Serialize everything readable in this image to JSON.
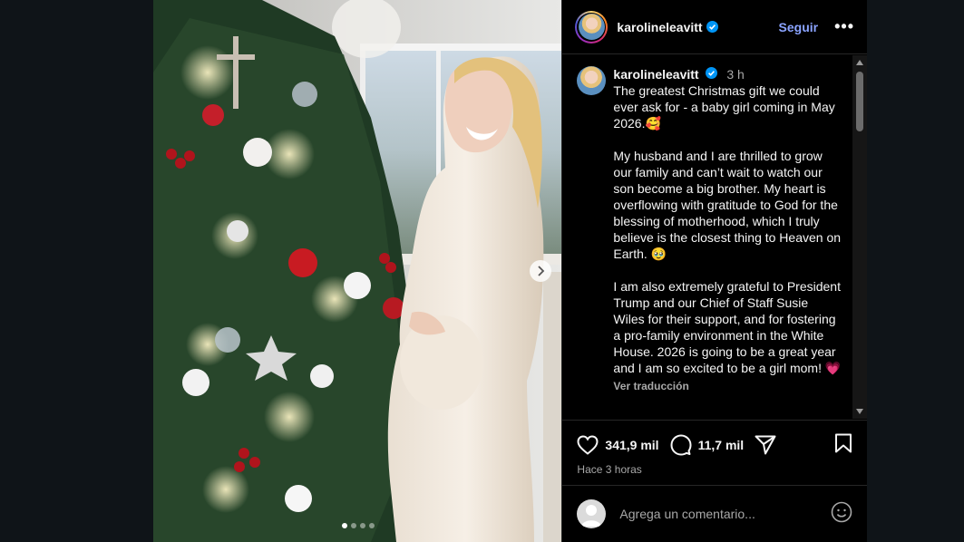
{
  "post": {
    "username": "karolineleavitt",
    "follow_label": "Seguir",
    "more_label": "•••",
    "media": {
      "slide_count": 4,
      "active_slide": 1
    }
  },
  "caption": {
    "username": "karolineleavitt",
    "time": "3 h",
    "text": "The greatest Christmas gift we could ever ask for - a baby girl coming in May 2026.🥰\n\nMy husband and I are thrilled to grow our family and can’t wait to watch our son become a big brother. My heart is overflowing with gratitude to God for the blessing of motherhood, which I truly believe is the closest thing to Heaven on Earth. 🥹\n\nI am also extremely grateful to President Trump and our Chief of Staff Susie Wiles for their support, and for fostering a pro-family environment in the White House. 2026 is going to be a great year and I am so excited to be a girl mom! 💗",
    "translate_label": "Ver traducción"
  },
  "actions": {
    "likes": "341,9 mil",
    "comments": "11,7 mil",
    "posted_ago": "Hace 3 horas"
  },
  "comment_box": {
    "placeholder": "Agrega un comentario..."
  },
  "colors": {
    "follow": "#8aa3ff",
    "verified": "#0095f6",
    "background": "#0f1418"
  }
}
